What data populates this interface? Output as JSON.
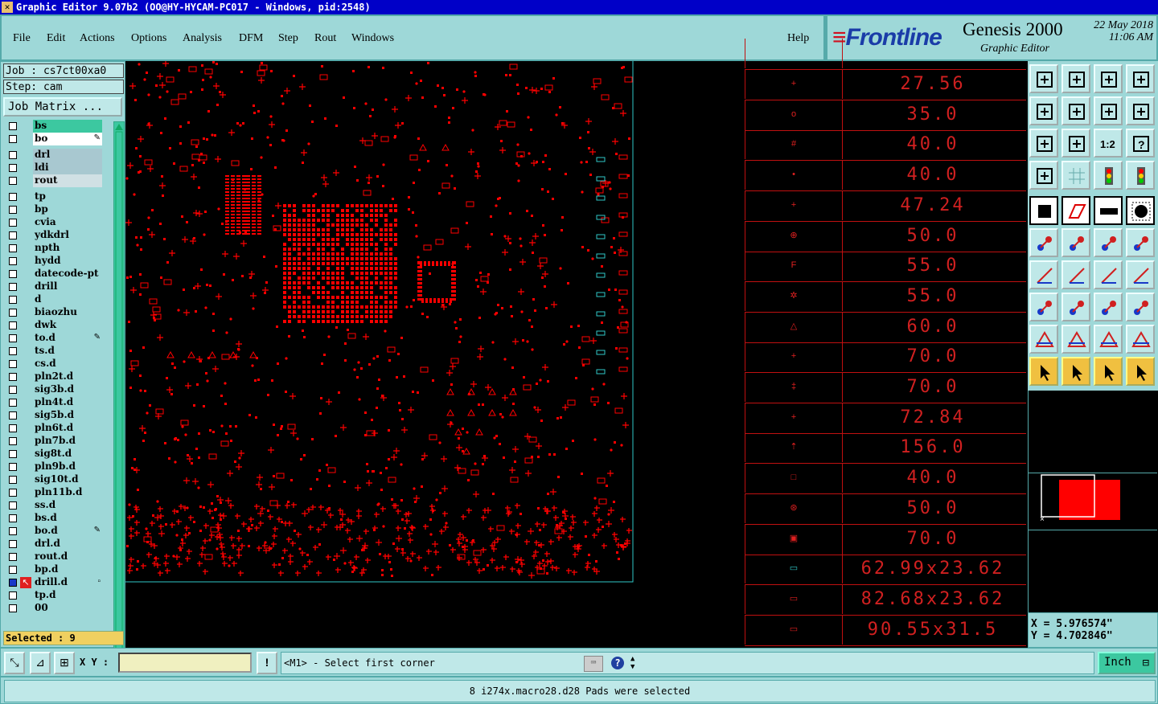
{
  "window": {
    "title": "Graphic Editor 9.07b2 (OO@HY-HYCAM-PC017 - Windows, pid:2548)"
  },
  "menubar": {
    "items": [
      {
        "label": "File"
      },
      {
        "label": "Edit"
      },
      {
        "label": "Actions"
      },
      {
        "label": "Options"
      },
      {
        "label": "Analysis"
      },
      {
        "label": "DFM"
      },
      {
        "label": "Step"
      },
      {
        "label": "Rout"
      },
      {
        "label": "Windows"
      }
    ],
    "help": "Help"
  },
  "logo": {
    "brand": "Frontline",
    "product": "Genesis 2000",
    "subtitle": "Graphic Editor",
    "date": "22 May 2018",
    "time": "11:06 AM"
  },
  "job": {
    "job_label": "Job : cs7ct00xa0",
    "step_label": "Step: cam",
    "matrix_button": "Job Matrix ..."
  },
  "layers": [
    {
      "name": "bs",
      "style": "hl"
    },
    {
      "name": "bo",
      "style": "wh",
      "edit": true
    },
    {
      "name": "drl",
      "style": "gr"
    },
    {
      "name": "ldi",
      "style": "gr"
    },
    {
      "name": "rout",
      "style": "lt"
    },
    {
      "name": "tp"
    },
    {
      "name": "bp"
    },
    {
      "name": "cvia"
    },
    {
      "name": "ydkdrl"
    },
    {
      "name": "npth"
    },
    {
      "name": "hydd"
    },
    {
      "name": "datecode-pt"
    },
    {
      "name": "drill"
    },
    {
      "name": "d"
    },
    {
      "name": "biaozhu"
    },
    {
      "name": "dwk"
    },
    {
      "name": "to.d",
      "edit": true
    },
    {
      "name": "ts.d"
    },
    {
      "name": "cs.d"
    },
    {
      "name": "pln2t.d"
    },
    {
      "name": "sig3b.d"
    },
    {
      "name": "pln4t.d"
    },
    {
      "name": "sig5b.d"
    },
    {
      "name": "pln6t.d"
    },
    {
      "name": "pln7b.d"
    },
    {
      "name": "sig8t.d"
    },
    {
      "name": "pln9b.d"
    },
    {
      "name": "sig10t.d"
    },
    {
      "name": "pln11b.d"
    },
    {
      "name": "ss.d"
    },
    {
      "name": "bs.d"
    },
    {
      "name": "bo.d",
      "edit": true
    },
    {
      "name": "drl.d"
    },
    {
      "name": "rout.d"
    },
    {
      "name": "bp.d"
    },
    {
      "name": "drill.d",
      "work": true
    },
    {
      "name": "tp.d"
    },
    {
      "name": "00"
    }
  ],
  "selected_label": "Selected : 9",
  "symbols": [
    {
      "value": "27.56"
    },
    {
      "value": "35.0"
    },
    {
      "value": "40.0"
    },
    {
      "value": "40.0"
    },
    {
      "value": "47.24"
    },
    {
      "value": "50.0"
    },
    {
      "value": "55.0"
    },
    {
      "value": "55.0"
    },
    {
      "value": "60.0"
    },
    {
      "value": "70.0"
    },
    {
      "value": "70.0"
    },
    {
      "value": "72.84"
    },
    {
      "value": "156.0"
    },
    {
      "value": "40.0"
    },
    {
      "value": "50.0"
    },
    {
      "value": "70.0"
    },
    {
      "value": "62.99x23.62"
    },
    {
      "value": "82.68x23.62"
    },
    {
      "value": "90.55x31.5"
    }
  ],
  "coords": {
    "x": "X = 5.976574\"",
    "y": "Y = 4.702846\""
  },
  "command": {
    "xy_label": "X Y :",
    "xy_value": "",
    "prompt": "<M1> - Select first corner",
    "unit": "Inch"
  },
  "status": "8 i274x.macro28.d28 Pads were selected",
  "colors": {
    "panel": "#9ed8d8",
    "feature": "#ff0000",
    "titlebar": "#0000c8"
  }
}
